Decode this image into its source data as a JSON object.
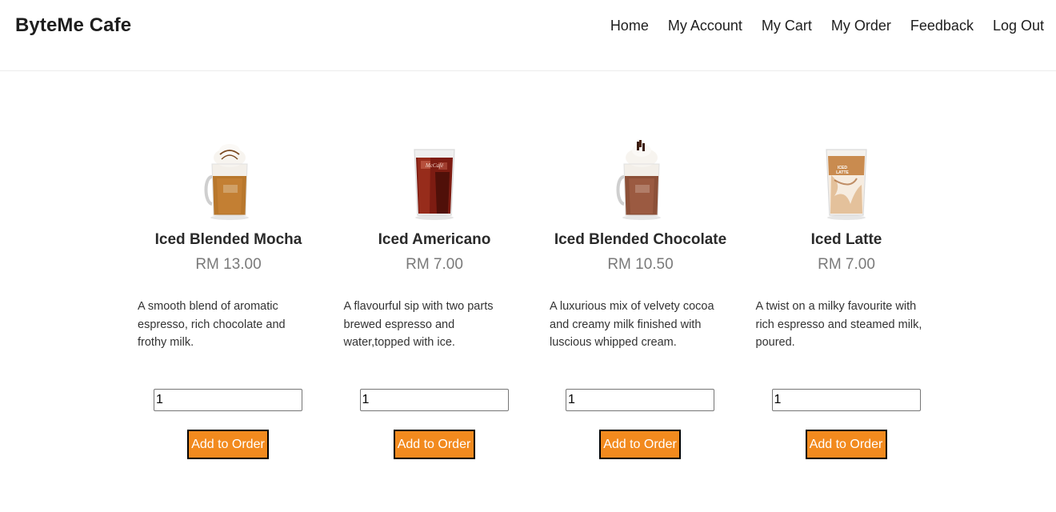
{
  "brand": "ByteMe Cafe",
  "nav": [
    "Home",
    "My Account",
    "My Cart",
    "My Order",
    "Feedback",
    "Log Out"
  ],
  "products": [
    {
      "name": "Iced Blended Mocha",
      "price": "RM 13.00",
      "description": "A smooth blend of aromatic espresso, rich chocolate and frothy milk.",
      "quantity": "1",
      "button": "Add to Order",
      "image": "iced-blended-mocha-image"
    },
    {
      "name": "Iced Americano",
      "price": "RM 7.00",
      "description": "A flavourful sip with two parts brewed espresso and water,topped with ice.",
      "quantity": "1",
      "button": "Add to Order",
      "image": "iced-americano-image"
    },
    {
      "name": "Iced Blended Chocolate",
      "price": "RM 10.50",
      "description": "A luxurious mix of velvety cocoa and creamy milk finished with luscious whipped cream.",
      "quantity": "1",
      "button": "Add to Order",
      "image": "iced-blended-chocolate-image"
    },
    {
      "name": "Iced Latte",
      "price": "RM 7.00",
      "description": "A twist on a milky favourite with rich espresso and steamed milk, poured.",
      "quantity": "1",
      "button": "Add to Order",
      "image": "iced-latte-image"
    }
  ],
  "colors": {
    "button_bg": "#f28a1e",
    "button_text": "#ffffff",
    "price_text": "#7a7a7a"
  }
}
